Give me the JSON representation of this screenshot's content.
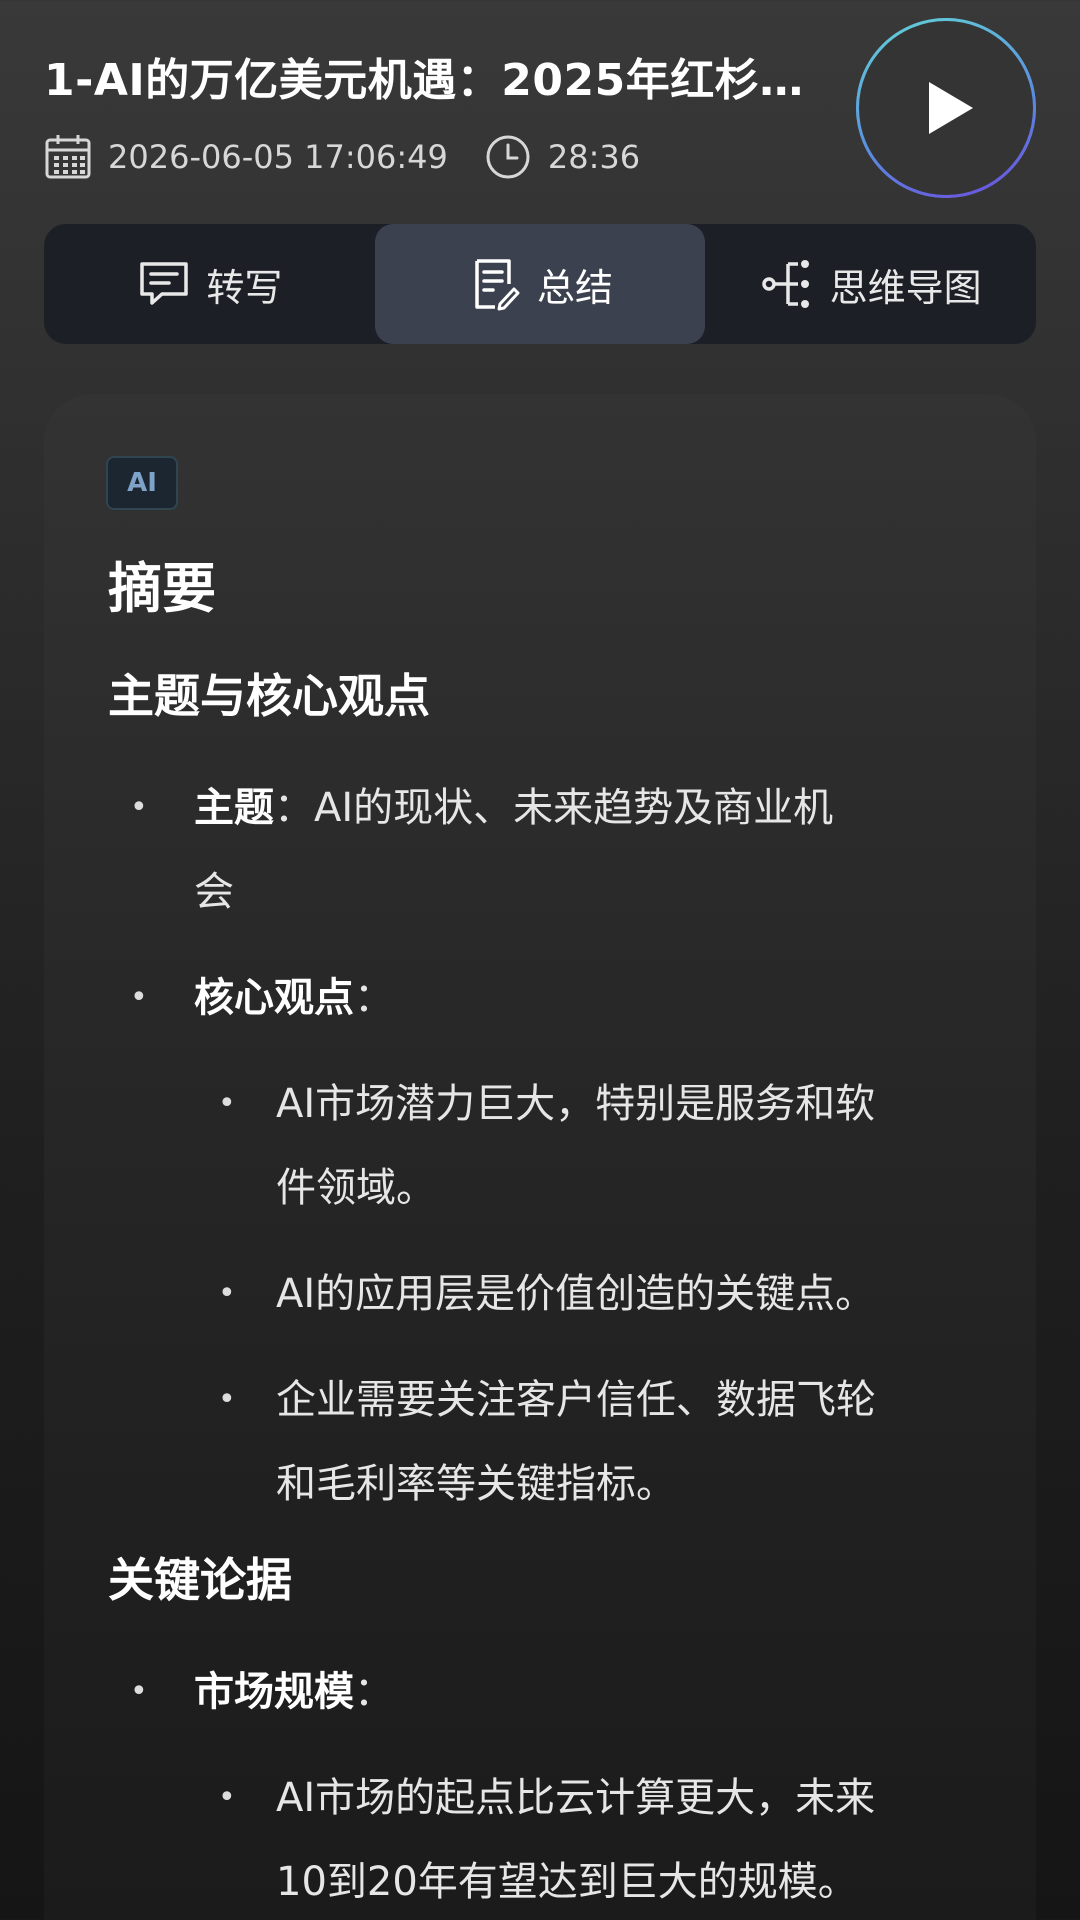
{
  "header": {
    "title": "1-AI的万亿美元机遇：2025年红杉…",
    "date": "2026-06-05 17:06:49",
    "duration": "28:36",
    "date_icon": "calendar-icon",
    "duration_icon": "clock-icon",
    "play_icon": "play-icon"
  },
  "tabs": [
    {
      "label": "转写",
      "icon": "transcript-icon",
      "active": false
    },
    {
      "label": "总结",
      "icon": "summary-icon",
      "active": true
    },
    {
      "label": "思维导图",
      "icon": "mindmap-icon",
      "active": false
    }
  ],
  "card": {
    "badge": "AI",
    "heading": "摘要",
    "section1": {
      "title": "主题与核心观点",
      "topic_label": "主题",
      "topic_sep": "：",
      "topic_text": "AI的现状、未来趋势及商业机",
      "topic_text_cont": "会",
      "core_label": "核心观点",
      "core_sep": "：",
      "core_points": [
        {
          "line1": "AI市场潜力巨大，特别是服务和软",
          "line2": "件领域。"
        },
        {
          "line1": "AI的应用层是价值创造的关键点。",
          "line2": ""
        },
        {
          "line1": "企业需要关注客户信任、数据飞轮",
          "line2": "和毛利率等关键指标。"
        }
      ]
    },
    "section2": {
      "title": "关键论据",
      "market_label": "市场规模",
      "market_sep": "：",
      "market_points": [
        {
          "line1": "AI市场的起点比云计算更大，未来",
          "line2": "10到20年有望达到巨大的规模。"
        }
      ]
    }
  },
  "colors": {
    "accent_ring_start": "#63d4d6",
    "accent_ring_end": "#6d49e0",
    "tab_bg": "#1c1f26",
    "tab_active_bg": "#3b414e",
    "badge_text": "#7ea2c8"
  }
}
